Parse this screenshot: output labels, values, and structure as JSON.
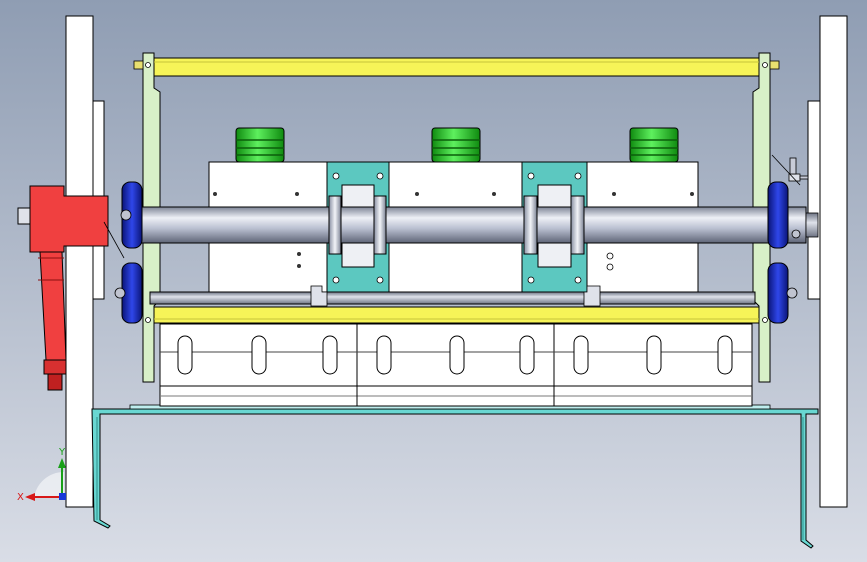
{
  "viewport": {
    "background_top": "#8f9db3",
    "background_bottom": "#d9dde6"
  },
  "colors": {
    "frame_white": "#ffffff",
    "side_plate_green": "#d8f0c8",
    "beam_yellow": "#f6f458",
    "gearbox_red": "#f04040",
    "bearing_blue": "#1c2fc8",
    "motor_green": "#22c422",
    "bracket_teal": "#5cc8c0",
    "tray_cyan": "#69d7d2",
    "shaft_steel": "#b9bfd0"
  },
  "triad": {
    "x_label": "X",
    "y_label": "Y",
    "x_color": "#d81818",
    "y_color": "#18a018",
    "z_color": "#1838d8"
  }
}
